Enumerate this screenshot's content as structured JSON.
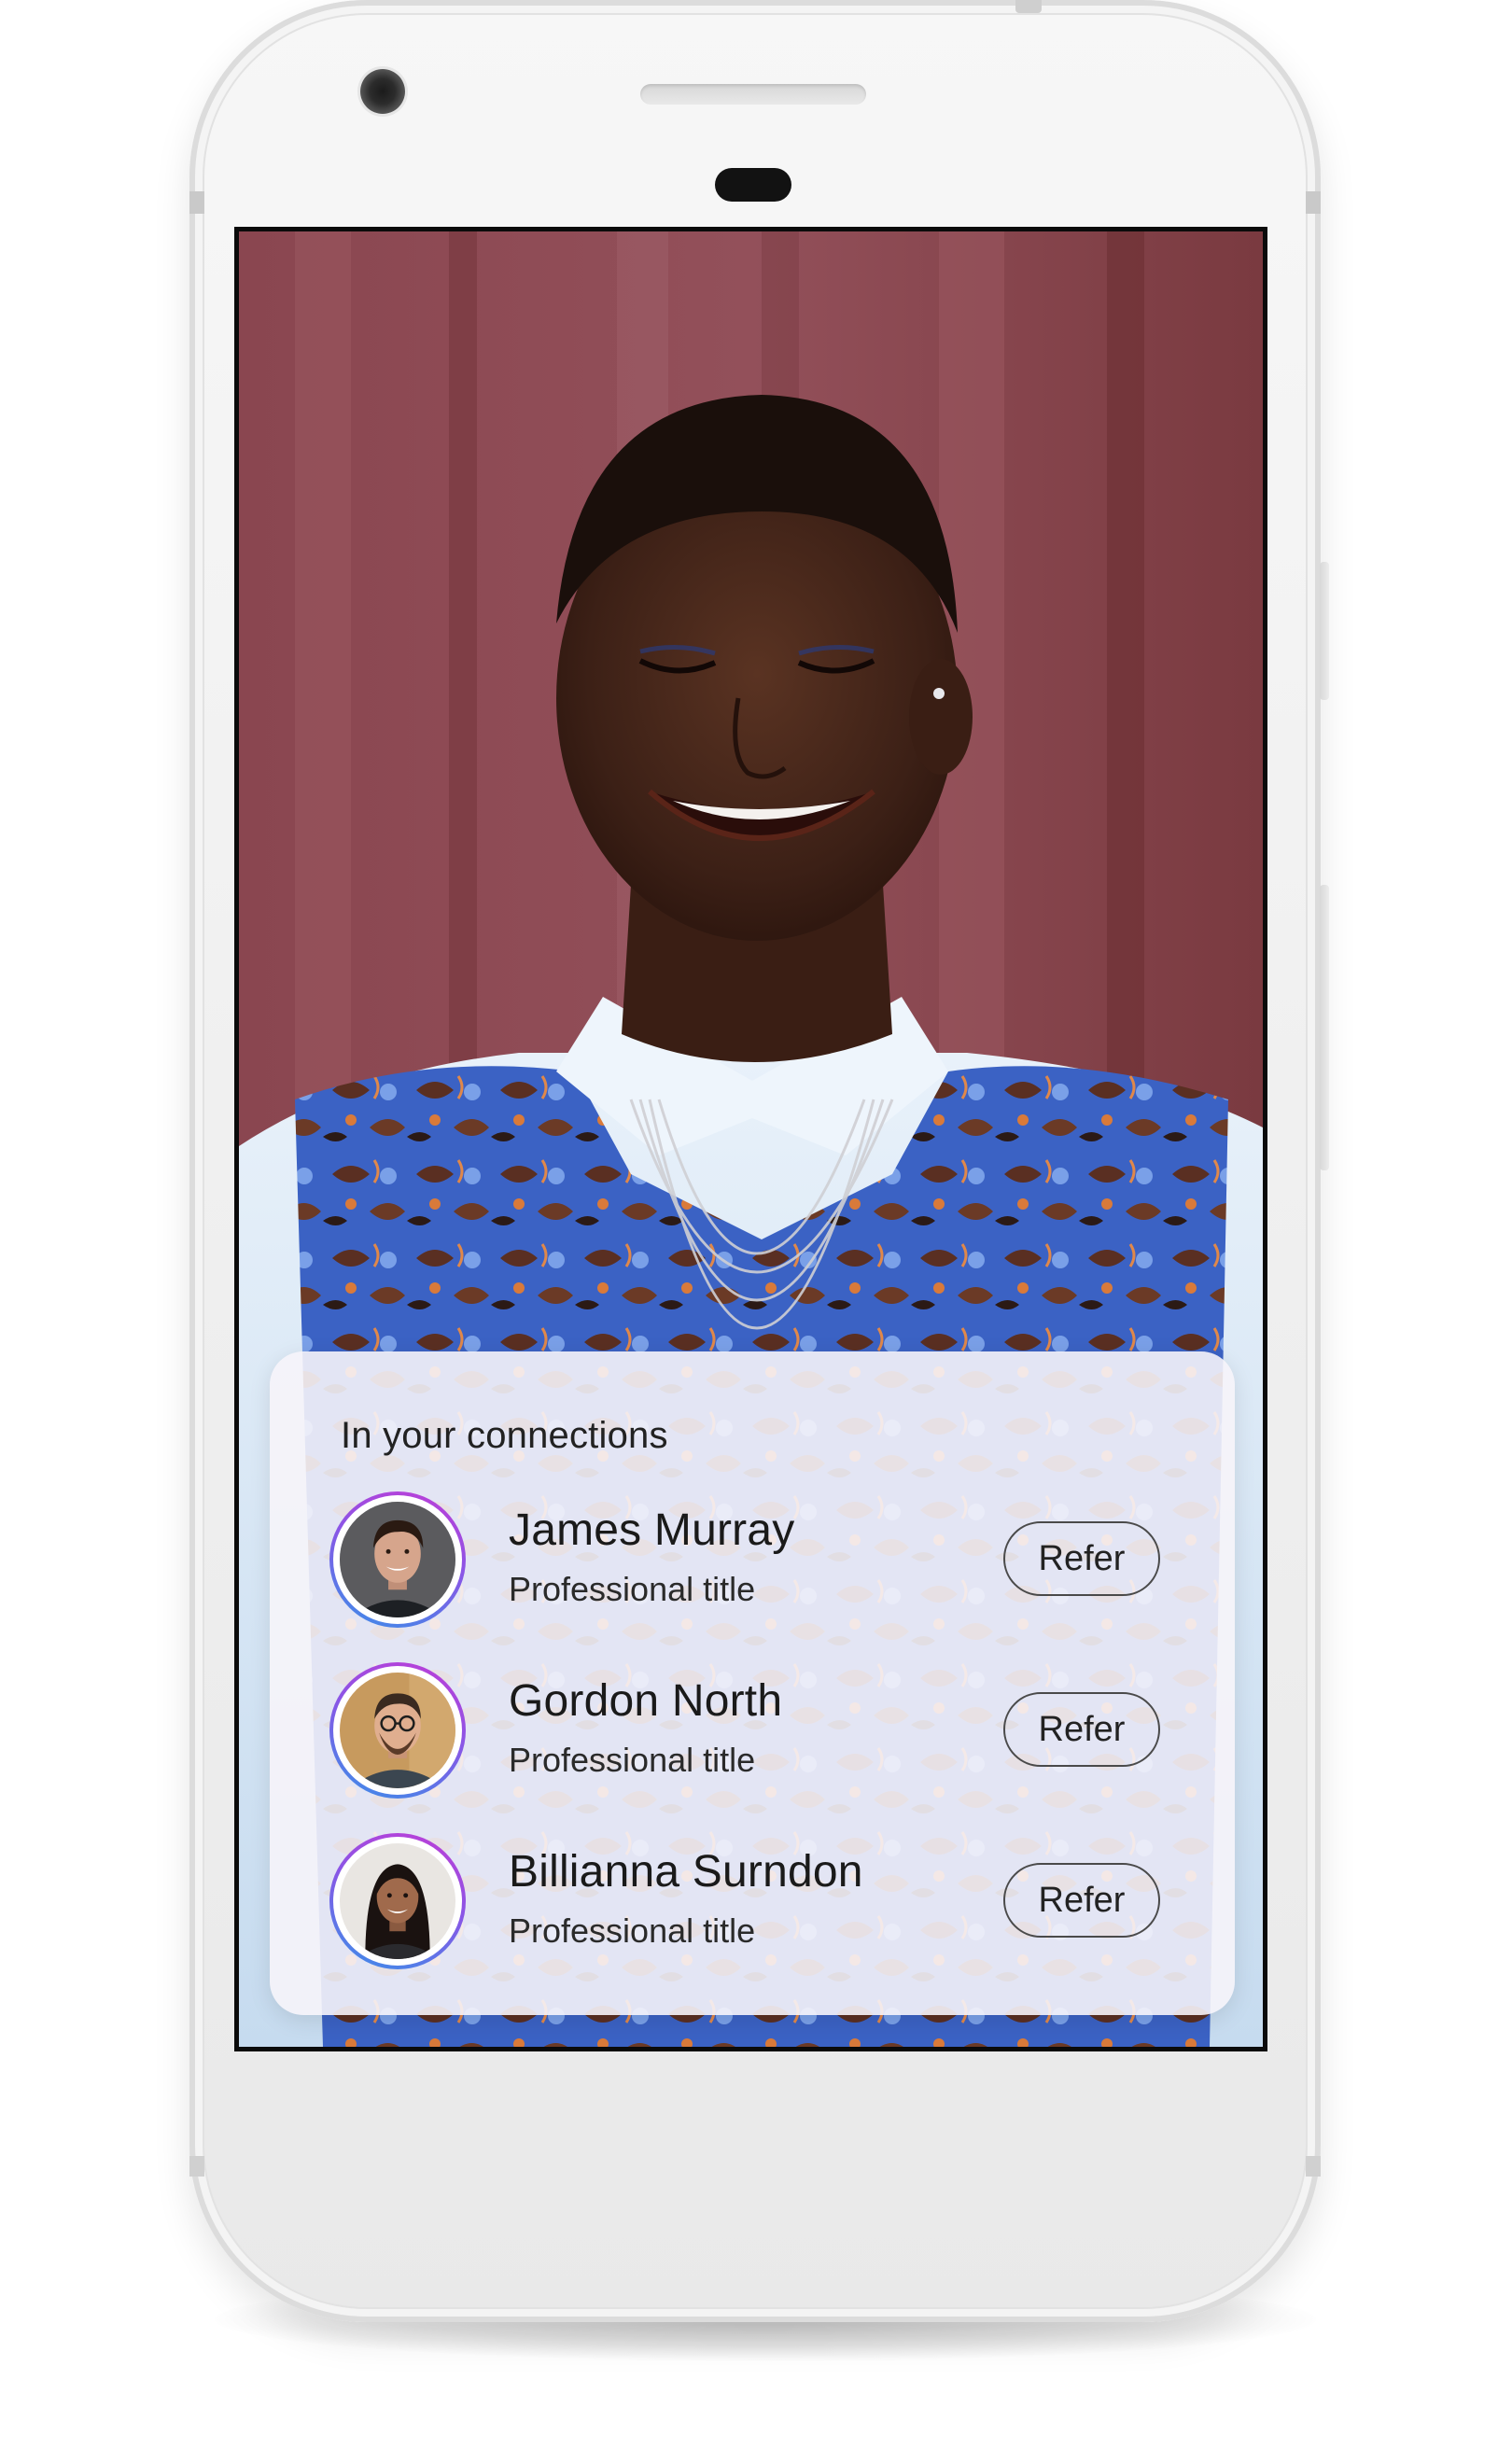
{
  "connections_card": {
    "title": "In your connections",
    "people": [
      {
        "name": "James Murray",
        "title": "Professional title",
        "action_label": "Refer"
      },
      {
        "name": "Gordon North",
        "title": "Professional title",
        "action_label": "Refer"
      },
      {
        "name": "Billianna Surndon",
        "title": "Professional title",
        "action_label": "Refer"
      }
    ]
  },
  "colors": {
    "avatar_ring_start": "#c13cd6",
    "avatar_ring_end": "#3a8fe8",
    "card_background": "#f6f4fa",
    "button_border": "#4a4a4a"
  }
}
